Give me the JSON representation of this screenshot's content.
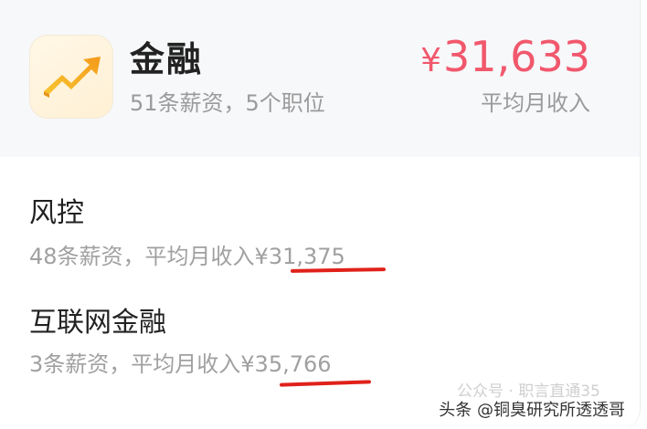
{
  "industry": {
    "name": "金融",
    "meta": "51条薪资，5个职位",
    "avg_currency": "¥",
    "avg_value": "31,633",
    "avg_label": "平均月收入",
    "icon": "trending-up-icon"
  },
  "jobs": [
    {
      "title": "风控",
      "meta_prefix": "48条薪资，平均月收入",
      "salary": "¥31,375"
    },
    {
      "title": "互联网金融",
      "meta_prefix": "3条薪资，平均月收入",
      "salary": "¥35,766"
    }
  ],
  "watermark": {
    "faint": "公众号 · 职言直通35",
    "text": "头条 @铜臭研究所透透哥"
  },
  "colors": {
    "accent": "#f1586c",
    "underline": "#e0211a",
    "icon_gold": "#f5b21a"
  }
}
